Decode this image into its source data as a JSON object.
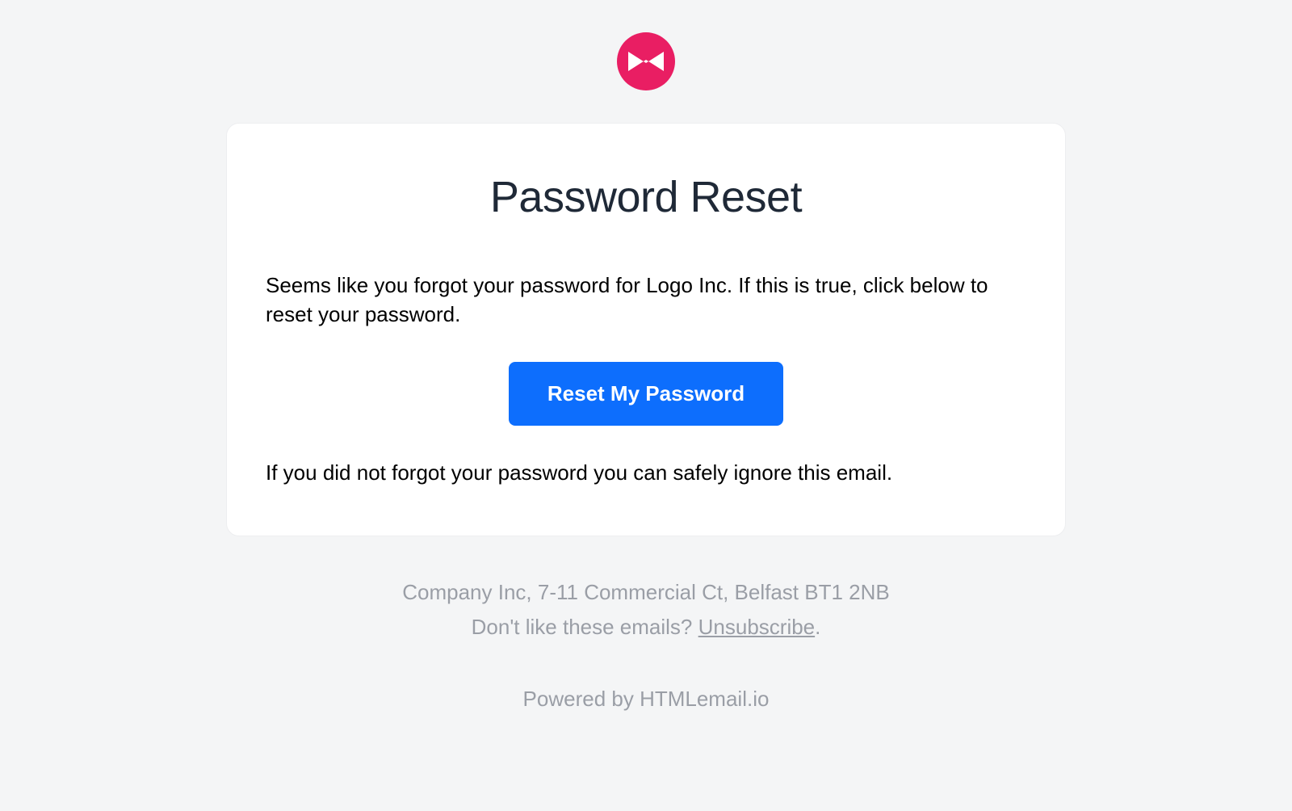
{
  "header": {
    "title": "Password Reset"
  },
  "body": {
    "intro_text": "Seems like you forgot your password for Logo Inc. If this is true, click below to reset your password.",
    "button_label": "Reset My Password",
    "footnote_text": "If you did not forgot your password you can safely ignore this email."
  },
  "footer": {
    "address": "Company Inc, 7-11 Commercial Ct, Belfast BT1 2NB",
    "unsubscribe_prompt": "Don't like these emails? ",
    "unsubscribe_label": "Unsubscribe",
    "unsubscribe_suffix": ".",
    "powered_by": "Powered by HTMLemail.io"
  },
  "colors": {
    "logo_pink": "#e91e63",
    "button_blue": "#0d6efd",
    "bg_gray": "#f4f5f6",
    "footer_gray": "#9a9ea6"
  }
}
